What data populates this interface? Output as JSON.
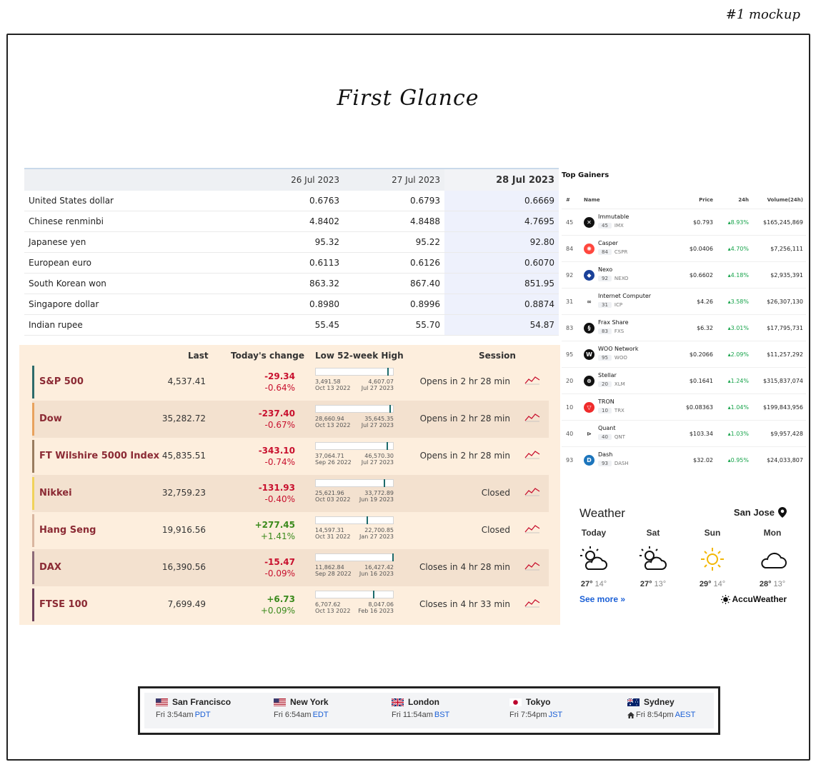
{
  "mockup_label": "#1 mockup",
  "page_title": "First Glance",
  "fx_table": {
    "columns": [
      "26 Jul 2023",
      "27 Jul 2023",
      "28 Jul 2023"
    ],
    "rows": [
      {
        "name": "United States dollar",
        "values": [
          "0.6763",
          "0.6793",
          "0.6669"
        ]
      },
      {
        "name": "Chinese renminbi",
        "values": [
          "4.8402",
          "4.8488",
          "4.7695"
        ]
      },
      {
        "name": "Japanese yen",
        "values": [
          "95.32",
          "95.22",
          "92.80"
        ]
      },
      {
        "name": "European euro",
        "values": [
          "0.6113",
          "0.6126",
          "0.6070"
        ]
      },
      {
        "name": "South Korean won",
        "values": [
          "863.32",
          "867.40",
          "851.95"
        ]
      },
      {
        "name": "Singapore dollar",
        "values": [
          "0.8980",
          "0.8996",
          "0.8874"
        ]
      },
      {
        "name": "Indian rupee",
        "values": [
          "55.45",
          "55.70",
          "54.87"
        ]
      }
    ]
  },
  "markets": {
    "headers": {
      "last": "Last",
      "change": "Today's change",
      "range": "Low 52-week High",
      "session": "Session"
    },
    "rows": [
      {
        "name": "S&P 500",
        "last": "4,537.41",
        "change": "-29.34",
        "pct": "-0.64%",
        "dir": "neg",
        "low": "3,491.58",
        "low_date": "Oct 13 2022",
        "high": "4,607.07",
        "high_date": "Jul 27 2023",
        "position": 0.93,
        "session": "Opens in 2 hr 28 min",
        "accent": "#2d6b6b"
      },
      {
        "name": "Dow",
        "last": "35,282.72",
        "change": "-237.40",
        "pct": "-0.67%",
        "dir": "neg",
        "low": "28,660.94",
        "low_date": "Oct 13 2022",
        "high": "35,645.35",
        "high_date": "Jul 27 2023",
        "position": 0.95,
        "session": "Opens in 2 hr 28 min",
        "accent": "#e8a25e"
      },
      {
        "name": "FT Wilshire 5000 Index",
        "last": "45,835.51",
        "change": "-343.10",
        "pct": "-0.74%",
        "dir": "neg",
        "low": "37,064.71",
        "low_date": "Sep 26 2022",
        "high": "46,570.30",
        "high_date": "Jul 27 2023",
        "position": 0.92,
        "session": "Opens in 2 hr 28 min",
        "accent": "#9a7d5f"
      },
      {
        "name": "Nikkei",
        "last": "32,759.23",
        "change": "-131.93",
        "pct": "-0.40%",
        "dir": "neg",
        "low": "25,621.96",
        "low_date": "Oct 03 2022",
        "high": "33,772.89",
        "high_date": "Jun 19 2023",
        "position": 0.88,
        "session": "Closed",
        "accent": "#f0d25a"
      },
      {
        "name": "Hang Seng",
        "last": "19,916.56",
        "change": "+277.45",
        "pct": "+1.41%",
        "dir": "pos",
        "low": "14,597.31",
        "low_date": "Oct 31 2022",
        "high": "22,700.85",
        "high_date": "Jan 27 2023",
        "position": 0.66,
        "session": "Closed",
        "accent": "#d9b6a0"
      },
      {
        "name": "DAX",
        "last": "16,390.56",
        "change": "-15.47",
        "pct": "-0.09%",
        "dir": "neg",
        "low": "11,862.84",
        "low_date": "Sep 28 2022",
        "high": "16,427.42",
        "high_date": "Jun 16 2023",
        "position": 0.99,
        "session": "Closes in 4 hr 28 min",
        "accent": "#8c6a78"
      },
      {
        "name": "FTSE 100",
        "last": "7,699.49",
        "change": "+6.73",
        "pct": "+0.09%",
        "dir": "pos",
        "low": "6,707.62",
        "low_date": "Oct 13 2022",
        "high": "8,047.06",
        "high_date": "Feb 16 2023",
        "position": 0.74,
        "session": "Closes in 4 hr 33 min",
        "accent": "#6b3f5a"
      }
    ]
  },
  "top_gainers": {
    "title": "Top Gainers",
    "headers": {
      "rank": "#",
      "name": "Name",
      "price": "Price",
      "change": "24h",
      "volume": "Volume(24h)"
    },
    "rows": [
      {
        "rank": "45",
        "name": "Immutable",
        "cap_rank": "45",
        "symbol": "IMX",
        "price": "$0.793",
        "change": "8.93%",
        "volume": "$165,245,869",
        "icon": "immutable-icon",
        "color": "#111111",
        "glyph": "✕"
      },
      {
        "rank": "84",
        "name": "Casper",
        "cap_rank": "84",
        "symbol": "CSPR",
        "price": "$0.0406",
        "change": "4.70%",
        "volume": "$7,256,111",
        "icon": "casper-icon",
        "color": "#ff473e",
        "glyph": "✺"
      },
      {
        "rank": "92",
        "name": "Nexo",
        "cap_rank": "92",
        "symbol": "NEXO",
        "price": "$0.6602",
        "change": "4.18%",
        "volume": "$2,935,391",
        "icon": "nexo-icon",
        "color": "#1a4199",
        "glyph": "◆"
      },
      {
        "rank": "31",
        "name": "Internet Computer",
        "cap_rank": "31",
        "symbol": "ICP",
        "price": "$4.26",
        "change": "3.58%",
        "volume": "$26,307,130",
        "icon": "internet-computer-icon",
        "color": "#ffffff",
        "glyph": "∞"
      },
      {
        "rank": "83",
        "name": "Frax Share",
        "cap_rank": "83",
        "symbol": "FXS",
        "price": "$6.32",
        "change": "3.01%",
        "volume": "$17,795,731",
        "icon": "frax-share-icon",
        "color": "#111111",
        "glyph": "§"
      },
      {
        "rank": "95",
        "name": "WOO Network",
        "cap_rank": "95",
        "symbol": "WOO",
        "price": "$0.2066",
        "change": "2.09%",
        "volume": "$11,257,292",
        "icon": "woo-network-icon",
        "color": "#111111",
        "glyph": "W"
      },
      {
        "rank": "20",
        "name": "Stellar",
        "cap_rank": "20",
        "symbol": "XLM",
        "price": "$0.1641",
        "change": "1.24%",
        "volume": "$315,837,074",
        "icon": "stellar-icon",
        "color": "#111111",
        "glyph": "⊛"
      },
      {
        "rank": "10",
        "name": "TRON",
        "cap_rank": "10",
        "symbol": "TRX",
        "price": "$0.08363",
        "change": "1.04%",
        "volume": "$199,843,956",
        "icon": "tron-icon",
        "color": "#ef2b2b",
        "glyph": "▽"
      },
      {
        "rank": "40",
        "name": "Quant",
        "cap_rank": "40",
        "symbol": "QNT",
        "price": "$103.34",
        "change": "1.03%",
        "volume": "$9,957,428",
        "icon": "quant-icon",
        "color": "#ffffff",
        "glyph": "⊳"
      },
      {
        "rank": "93",
        "name": "Dash",
        "cap_rank": "93",
        "symbol": "DASH",
        "price": "$32.02",
        "change": "0.95%",
        "volume": "$24,033,807",
        "icon": "dash-icon",
        "color": "#1c75bc",
        "glyph": "D"
      }
    ]
  },
  "weather": {
    "title": "Weather",
    "location": "San Jose",
    "days": [
      {
        "day": "Today",
        "high": "27°",
        "low": "14°",
        "icon": "partly-sunny-icon"
      },
      {
        "day": "Sat",
        "high": "27°",
        "low": "13°",
        "icon": "partly-sunny-icon"
      },
      {
        "day": "Sun",
        "high": "29°",
        "low": "14°",
        "icon": "sunny-icon"
      },
      {
        "day": "Mon",
        "high": "28°",
        "low": "13°",
        "icon": "cloudy-icon"
      }
    ],
    "see_more": "See more »",
    "brand": "AccuWeather"
  },
  "world_clock": [
    {
      "city": "San Francisco",
      "time": "Fri 3:54am",
      "tz": "PDT",
      "flag": "us-flag-icon",
      "home": false
    },
    {
      "city": "New York",
      "time": "Fri 6:54am",
      "tz": "EDT",
      "flag": "us-flag-icon",
      "home": false
    },
    {
      "city": "London",
      "time": "Fri 11:54am",
      "tz": "BST",
      "flag": "uk-flag-icon",
      "home": false
    },
    {
      "city": "Tokyo",
      "time": "Fri 7:54pm",
      "tz": "JST",
      "flag": "japan-flag-icon",
      "home": false
    },
    {
      "city": "Sydney",
      "time": "Fri 8:54pm",
      "tz": "AEST",
      "flag": "australia-flag-icon",
      "home": true
    }
  ]
}
